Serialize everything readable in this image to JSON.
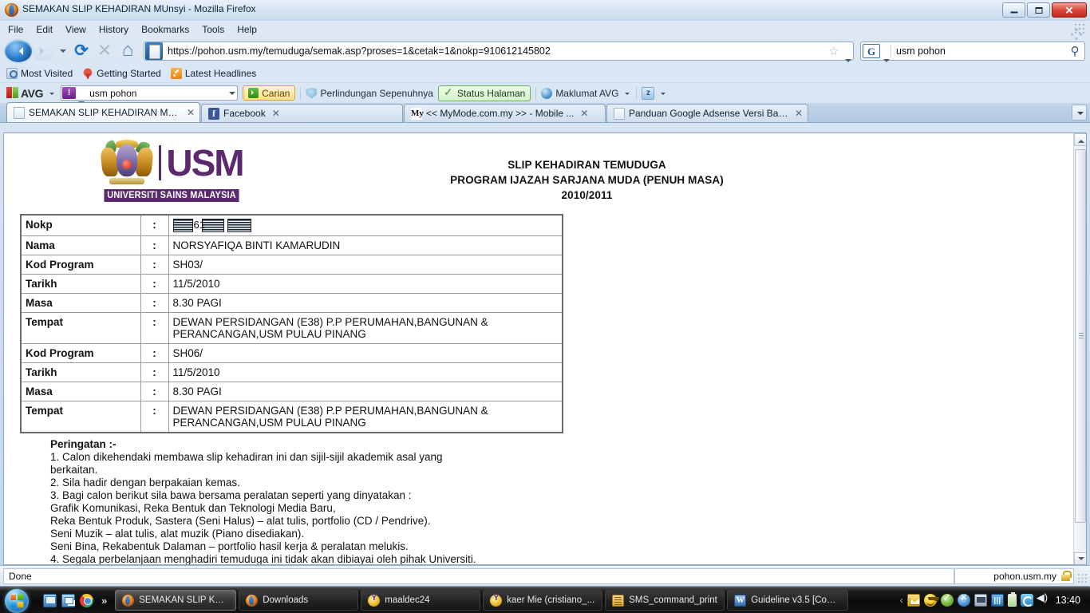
{
  "window": {
    "title": "SEMAKAN SLIP KEHADIRAN MUnsyi - Mozilla Firefox",
    "minimize_label": "",
    "maximize_label": "",
    "close_label": "✕"
  },
  "menubar": [
    {
      "label": "File"
    },
    {
      "label": "Edit"
    },
    {
      "label": "View"
    },
    {
      "label": "History"
    },
    {
      "label": "Bookmarks"
    },
    {
      "label": "Tools"
    },
    {
      "label": "Help"
    }
  ],
  "navbar": {
    "url": "https://pohon.usm.my/temuduga/semak.asp?proses=1&cetak=1&nokp=910612145802",
    "search_engine": "G",
    "search_value": "usm pohon"
  },
  "bookmarks": [
    {
      "label": "Most Visited"
    },
    {
      "label": "Getting Started"
    },
    {
      "label": "Latest Headlines"
    }
  ],
  "avgbar": {
    "brand": "AVG",
    "search_value": "usm pohon",
    "yahoo_glyph": "!",
    "search_button": "Carian",
    "protection_label": "Perlindungan Sepenuhnya",
    "page_status_label": "Status Halaman",
    "info_label": "Maklumat AVG",
    "last_icon_glyph": "z"
  },
  "tabs": [
    {
      "label": "SEMAKAN SLIP KEHADIRAN MUn...",
      "favicon": "document-icon",
      "favicon_glyph": "",
      "active": true
    },
    {
      "label": "Facebook",
      "favicon": "facebook-icon",
      "favicon_glyph": "f",
      "active": false
    },
    {
      "label": "<< MyMode.com.my >> - Mobile ...",
      "favicon": "mymode-icon",
      "favicon_glyph": "My",
      "active": false
    },
    {
      "label": "Panduan Google Adsense Versi Bah...",
      "favicon": "document-icon",
      "favicon_glyph": "",
      "active": false
    }
  ],
  "tab_close_glyph": "✕",
  "document": {
    "logo": {
      "letters": "USM",
      "name": "UNIVERSITI SAINS MALAYSIA"
    },
    "title_lines": [
      "SLIP KEHADIRAN TEMUDUGA",
      "PROGRAM IJAZAH SARJANA MUDA (PENUH MASA)",
      "2010/2011"
    ],
    "table": [
      {
        "label": "Nokp",
        "sep": ":",
        "value": "",
        "redacted": true,
        "redacted_visible": "61"
      },
      {
        "label": "Nama",
        "sep": ":",
        "value": "NORSYAFIQA BINTI KAMARUDIN"
      },
      {
        "label": "Kod Program",
        "sep": ":",
        "value": "SH03/"
      },
      {
        "label": "Tarikh",
        "sep": ":",
        "value": "11/5/2010"
      },
      {
        "label": "Masa",
        "sep": ":",
        "value": "8.30 PAGI"
      },
      {
        "label": "Tempat",
        "sep": ":",
        "value": "DEWAN PERSIDANGAN (E38) P.P PERUMAHAN,BANGUNAN & PERANCANGAN,USM PULAU PINANG"
      },
      {
        "label": "Kod Program",
        "sep": ":",
        "value": "SH06/"
      },
      {
        "label": "Tarikh",
        "sep": ":",
        "value": "11/5/2010"
      },
      {
        "label": "Masa",
        "sep": ":",
        "value": "8.30 PAGI"
      },
      {
        "label": "Tempat",
        "sep": ":",
        "value": "DEWAN PERSIDANGAN (E38) P.P PERUMAHAN,BANGUNAN & PERANCANGAN,USM PULAU PINANG"
      }
    ],
    "notes": {
      "heading": "Peringatan :-",
      "lines": [
        "1. Calon dikehendaki membawa slip kehadiran ini dan sijil-sijil akademik asal yang",
        "berkaitan.",
        "2. Sila hadir dengan berpakaian kemas.",
        "3. Bagi calon berikut sila bawa bersama peralatan seperti yang dinyatakan :",
        "Grafik Komunikasi, Reka Bentuk dan Teknologi Media Baru,",
        "Reka Bentuk Produk, Sastera (Seni Halus) – alat tulis, portfolio (CD / Pendrive).",
        "Seni Muzik – alat tulis, alat muzik (Piano disediakan).",
        "Seni Bina, Rekabentuk Dalaman – portfolio hasil kerja & peralatan melukis.",
        "4. Segala perbelanjaan menghadiri temuduga ini tidak akan dibiayai oleh pihak Universiti."
      ]
    }
  },
  "statusbar": {
    "left": "Done",
    "domain": "pohon.usm.my"
  },
  "taskbar": {
    "quicklaunch": [
      {
        "name": "show-desktop-icon"
      },
      {
        "name": "switch-windows-icon"
      },
      {
        "name": "chrome-icon"
      }
    ],
    "overflow_glyph": "»",
    "tasks": [
      {
        "label": "SEMAKAN SLIP KEH...",
        "icon": "firefox-icon",
        "active": true
      },
      {
        "label": "Downloads",
        "icon": "firefox-icon",
        "active": false
      },
      {
        "label": "maaldec24",
        "icon": "yahoo-messenger-icon",
        "active": false
      },
      {
        "label": "kaer Mie (cristiano_...",
        "icon": "yahoo-messenger-icon",
        "active": false
      },
      {
        "label": "SMS_command_print",
        "icon": "notepad-icon",
        "active": false
      },
      {
        "label": "Guideline v3.5 [Com...",
        "icon": "word-icon",
        "active": false
      }
    ],
    "tray_chevron": "‹",
    "clock": "13:40"
  }
}
